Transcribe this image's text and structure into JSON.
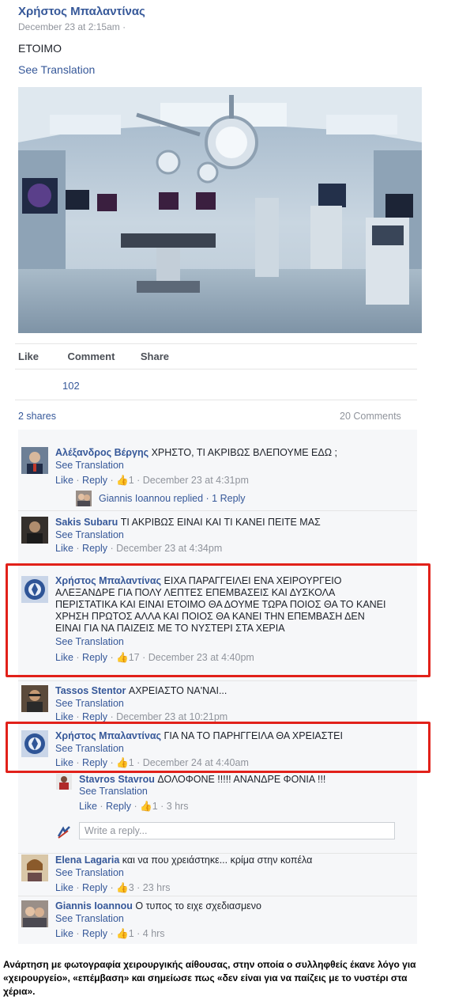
{
  "post": {
    "author": "Χρήστος Μπαλαντίνας",
    "timestamp": "December 23 at 2:15am ·",
    "text": "ΕΤΟΙΜΟ",
    "see_translation": "See Translation",
    "actions": {
      "like": "Like",
      "comment": "Comment",
      "share": "Share"
    },
    "likes_count": "102",
    "shares": "2 shares",
    "comments_count": "20 Comments"
  },
  "comments": [
    {
      "author": "Αλέξανδρος Βέργης",
      "text": "ΧΡΗΣΤΟ, ΤΙ ΑΚΡΙΒΩΣ ΒΛΕΠΟΥΜΕ ΕΔΩ ;",
      "see_translation": "See Translation",
      "like": "Like",
      "reply": "Reply",
      "likes": "1",
      "time": "December 23 at 4:31pm",
      "replies_link": {
        "name": "Giannis Ioannou",
        "text": "replied · 1 Reply"
      }
    },
    {
      "author": "Sakis Subaru",
      "text": "ΤΙ ΑΚΡΙΒΩΣ ΕΙΝΑΙ ΚΑΙ ΤΙ ΚΑΝΕΙ ΠΕΙΤΕ ΜΑΣ",
      "see_translation": "See Translation",
      "like": "Like",
      "reply": "Reply",
      "time": "December 23 at 4:34pm"
    },
    {
      "author": "Χρήστος Μπαλαντίνας",
      "line1": "ΕΙΧΑ ΠΑΡΑΓΓΕΙΛΕΙ ΕΝΑ ΧΕΙΡΟΥΡΓΕΙΟ",
      "line2": "ΑΛΕΞΑΝΔΡΕ ΓΙΑ ΠΟΛΥ ΛΕΠΤΕΣ ΕΠΕΜΒΑΣΕΙΣ ΚΑΙ ΔΥΣΚΟΛΑ",
      "line3": "ΠΕΡΙΣΤΑΤΙΚΑ ΚΑΙ ΕΙΝΑΙ ΕΤΟΙΜΟ ΘΑ ΔΟΥΜΕ ΤΩΡΑ ΠΟΙΟΣ ΘΑ ΤΟ ΚΑΝΕΙ",
      "line4": "ΧΡΗΣΗ ΠΡΩΤΟΣ ΑΛΛΑ ΚΑΙ ΠΟΙΟΣ ΘΑ ΚΑΝΕΙ ΤΗΝ ΕΠΕΜΒΑΣΗ ΔΕΝ",
      "line5": "ΕΙΝΑΙ ΓΙΑ ΝΑ ΠΑΙΖΕΙΣ ΜΕ ΤΟ ΝΥΣΤΕΡΙ ΣΤΑ ΧΕΡΙΑ",
      "see_translation": "See Translation",
      "like": "Like",
      "reply": "Reply",
      "likes": "17",
      "time": "December 23 at 4:40pm"
    },
    {
      "author": "Tassos Stentor",
      "text": "ΑΧΡΕΙΑΣΤΟ ΝΑ'ΝΑΙ...",
      "see_translation": "See Translation",
      "like": "Like",
      "reply": "Reply",
      "time": "December 23 at 10:21pm"
    },
    {
      "author": "Χρήστος Μπαλαντίνας",
      "text": "ΓΙΑ ΝΑ ΤΟ ΠΑΡΗΓΓΕΙΛΑ ΘΑ ΧΡΕΙΑΣΤΕΙ",
      "see_translation": "See Translation",
      "like": "Like",
      "reply": "Reply",
      "likes": "1",
      "time": "December 24 at 4:40am"
    },
    {
      "author": "Stavros Stavrou",
      "text": "ΔΟΛΟΦΟΝΕ !!!!! ΑΝΑΝΔΡΕ ΦΟΝΙΑ !!!",
      "see_translation": "See Translation",
      "like": "Like",
      "reply": "Reply",
      "likes": "1",
      "time": "3 hrs"
    },
    {
      "author": "Elena Lagaria",
      "text": "και να που χρειάστηκε... κρίμα στην κοπέλα",
      "see_translation": "See Translation",
      "like": "Like",
      "reply": "Reply",
      "likes": "3",
      "time": "23 hrs"
    },
    {
      "author": "Giannis Ioannou",
      "text": "Ο τυπος το ειχε σχεδιασμενο",
      "see_translation": "See Translation",
      "like": "Like",
      "reply": "Reply",
      "likes": "1",
      "time": "4 hrs"
    }
  ],
  "reply_placeholder": "Write a reply...",
  "caption": {
    "line1": "Ανάρτηση με φωτογραφία χειρουργικής αίθουσας, στην οποία ο συλληφθείς έκανε λόγο για",
    "line2": "«χειρουργείο», «επέμβαση» και σημείωσε πως «δεν είναι για να παίζεις με το νυστέρι στα",
    "line3": "χέρια»."
  }
}
